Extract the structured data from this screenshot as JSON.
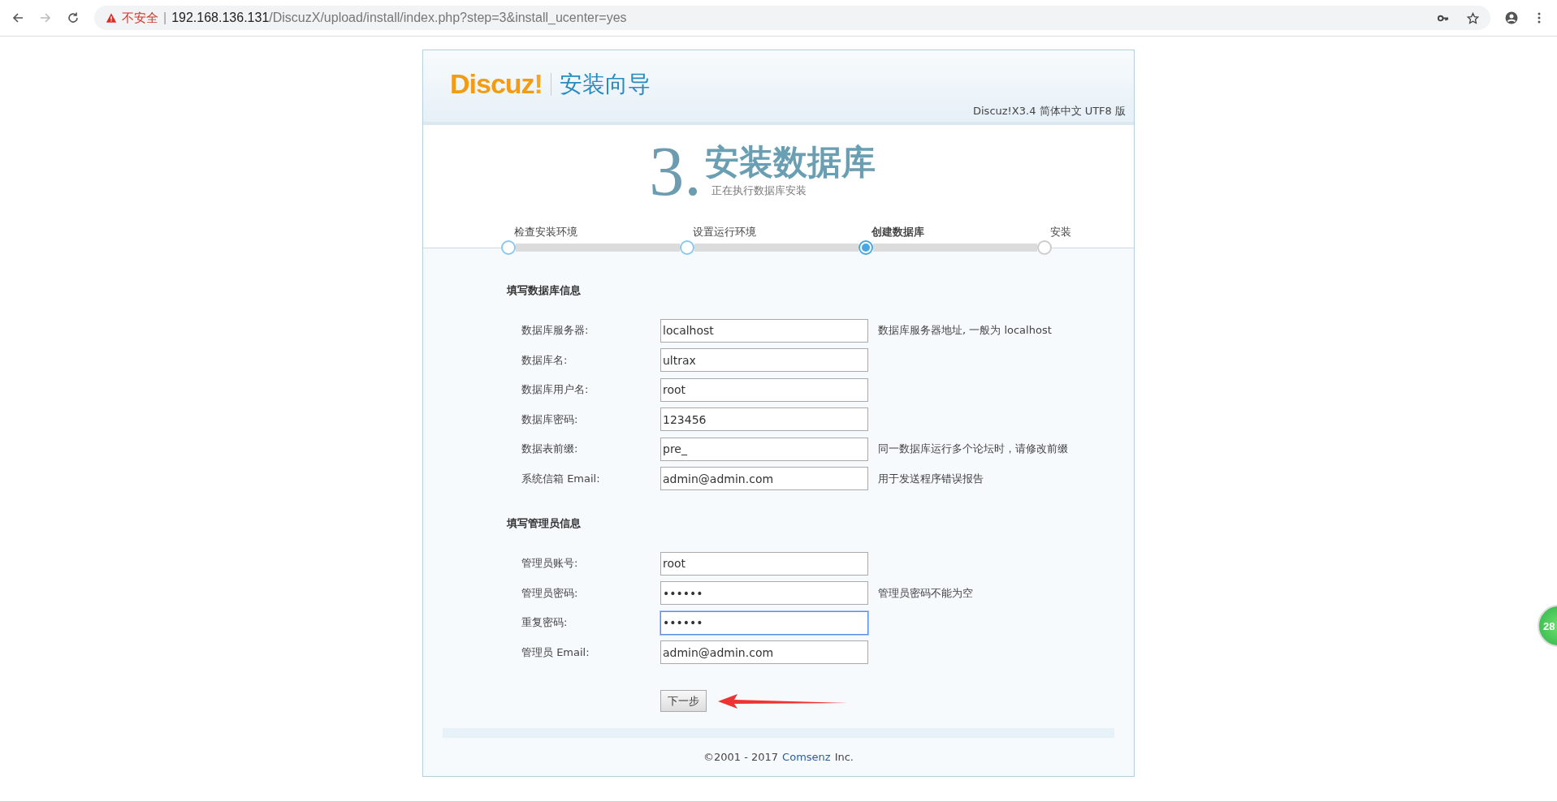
{
  "browser": {
    "security_label": "不安全",
    "separator": "|",
    "url_host": "192.168.136.131",
    "url_path": "/DiscuzX/upload/install/index.php?step=3&install_ucenter=yes",
    "forward_disabled": true
  },
  "header": {
    "logo": "Discuz",
    "logo_mark": "!",
    "title": "安装向导",
    "version": "Discuz!X3.4 简体中文 UTF8 版"
  },
  "step_heading": {
    "number": "3.",
    "title": "安装数据库",
    "subtitle": "正在执行数据库安装"
  },
  "steps": [
    {
      "label": "检查安装环境",
      "completed": true,
      "selected": false
    },
    {
      "label": "设置运行环境",
      "completed": true,
      "selected": false
    },
    {
      "label": "创建数据库",
      "completed": false,
      "selected": true
    },
    {
      "label": "安装",
      "completed": false,
      "selected": false
    }
  ],
  "sections": [
    {
      "title": "填写数据库信息",
      "fields": [
        {
          "label": "数据库服务器:",
          "value": "localhost",
          "hint": "数据库服务器地址, 一般为 localhost",
          "focused": false
        },
        {
          "label": "数据库名:",
          "value": "ultrax",
          "focused": false
        },
        {
          "label": "数据库用户名:",
          "value": "root",
          "focused": false
        },
        {
          "label": "数据库密码:",
          "value": "123456",
          "focused": false
        },
        {
          "label": "数据表前缀:",
          "value": "pre_",
          "hint": "同一数据库运行多个论坛时，请修改前缀",
          "focused": false
        },
        {
          "label": "系统信箱 Email:",
          "value": "admin@admin.com",
          "hint": "用于发送程序错误报告",
          "focused": false
        }
      ]
    },
    {
      "title": "填写管理员信息",
      "fields": [
        {
          "label": "管理员账号:",
          "value": "root",
          "focused": false
        },
        {
          "label": "管理员密码:",
          "value": "••••••",
          "hint": "管理员密码不能为空",
          "focused": false
        },
        {
          "label": "重复密码:",
          "value": "••••••",
          "focused": true
        },
        {
          "label": "管理员 Email:",
          "value": "admin@admin.com",
          "focused": false
        }
      ]
    }
  ],
  "next_button": "下一步",
  "footer": {
    "copyright": "©2001 - 2017",
    "company": "Comsenz",
    "suffix": "Inc."
  },
  "floating_badge": "28"
}
